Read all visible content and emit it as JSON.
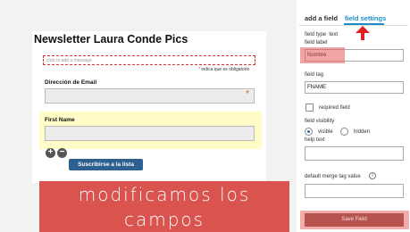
{
  "form": {
    "title": "Newsletter Laura Conde Pics",
    "message_placeholder": "click to add a message",
    "required_note": "indica que es obligatorio",
    "required_star": "*",
    "email_label": "Dirección de Email",
    "email_star": "*",
    "first_name_label": "First Name",
    "add_icon": "plus-icon",
    "remove_icon": "minus-icon",
    "subscribe_label": "Suscribirse a la lista"
  },
  "overlay": {
    "line1": "modificamos los",
    "line2": "campos"
  },
  "panel": {
    "tabs": [
      {
        "label": "add a field",
        "active": false
      },
      {
        "label": "field settings",
        "active": true
      }
    ],
    "field_type_label": "field type",
    "field_type_value": "text",
    "field_label_label": "field label",
    "field_label_value": "Nombre",
    "field_tag_label": "field tag",
    "field_tag_value": "FNAME",
    "required_label": "required field",
    "visibility_label": "field visibility",
    "visible_label": "visible",
    "hidden_label": "hidden",
    "visibility_selected": "visible",
    "help_text_label": "help text",
    "help_text_value": "",
    "default_merge_label": "default merge tag value",
    "default_merge_value": "",
    "info_icon": "info-icon",
    "save_label": "Save Field"
  },
  "colors": {
    "accent": "#1a8fc9",
    "highlight": "#e05a5a",
    "overlay": "#d9534f",
    "subscribe": "#2d5f8f"
  }
}
